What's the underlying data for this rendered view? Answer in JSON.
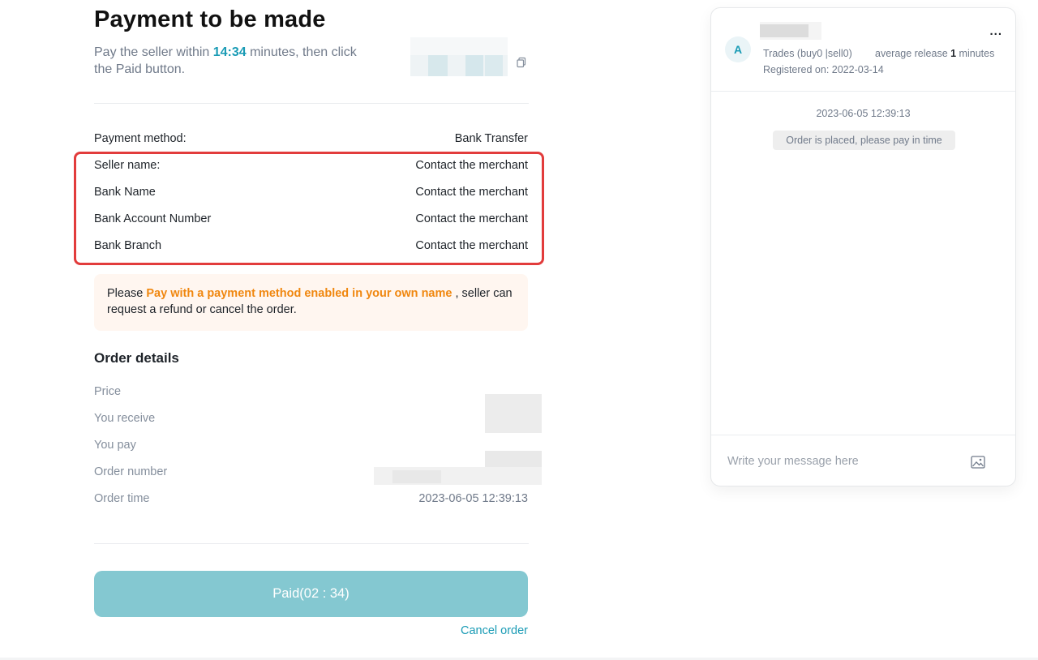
{
  "header": {
    "title": "Payment to be made",
    "subtitle_prefix": "Pay the seller within ",
    "timer": "14:34",
    "subtitle_suffix": " minutes, then click the Paid button."
  },
  "payment": {
    "method_label": "Payment method:",
    "method_value": "Bank Transfer",
    "rows": [
      {
        "label": "Seller name:",
        "value": "Contact the merchant"
      },
      {
        "label": "Bank Name",
        "value": "Contact the merchant"
      },
      {
        "label": "Bank Account Number",
        "value": "Contact the merchant"
      },
      {
        "label": "Bank Branch",
        "value": "Contact the merchant"
      }
    ]
  },
  "notice": {
    "prefix": "Please ",
    "highlight": "Pay with a payment method enabled in your own name",
    "suffix": " , seller can request a refund or cancel the order."
  },
  "order": {
    "title": "Order details",
    "rows": [
      {
        "label": "Price",
        "value": ""
      },
      {
        "label": "You receive",
        "value": ""
      },
      {
        "label": "You pay",
        "value": ""
      },
      {
        "label": "Order number",
        "value": ""
      },
      {
        "label": "Order time",
        "value": "2023-06-05 12:39:13"
      }
    ]
  },
  "actions": {
    "paid_label": "Paid(02 : 34)",
    "cancel_label": "Cancel order"
  },
  "chat": {
    "avatar_letter": "A",
    "trades": "Trades (buy0 |sell0)",
    "avg_prefix": "average release ",
    "avg_value": "1",
    "avg_suffix": " minutes",
    "registered": "Registered on: 2022-03-14",
    "timestamp": "2023-06-05 12:39:13",
    "system_message": "Order is placed, please pay in time",
    "input_placeholder": "Write your message here",
    "more_label": "..."
  },
  "colors": {
    "accent": "#1a9bb5",
    "highlight_orange": "#f0870f",
    "red_box": "#e23c3c",
    "paid_button": "#84c8d1"
  },
  "icons": [
    "copy-icon",
    "more-icon",
    "image-upload-icon"
  ]
}
